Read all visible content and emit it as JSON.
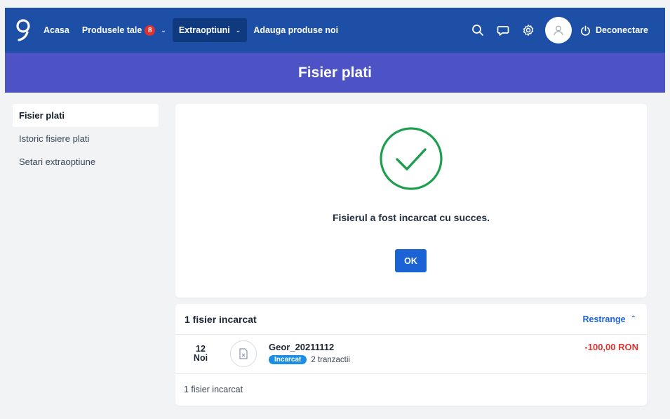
{
  "nav": {
    "home": "Acasa",
    "products": "Produsele tale",
    "products_badge": "8",
    "extras": "Extraoptiuni",
    "add_products": "Adauga produse noi",
    "logout": "Deconectare"
  },
  "page": {
    "title": "Fisier plati"
  },
  "sidebar": {
    "items": [
      {
        "label": "Fisier plati"
      },
      {
        "label": "Istoric fisiere plati"
      },
      {
        "label": "Setari extraoptiune"
      }
    ]
  },
  "success": {
    "message": "Fisierul a fost incarcat cu succes.",
    "ok_label": "OK"
  },
  "files": {
    "title": "1 fisier incarcat",
    "collapse_label": "Restrange",
    "rows": [
      {
        "day": "12",
        "month": "Noi",
        "name": "Geor_20211112",
        "status": "Incarcat",
        "transactions": "2 tranzactii",
        "amount": "-100,00 RON"
      }
    ],
    "footer": "1 fisier incarcat"
  },
  "colors": {
    "nav_bg": "#1e4fa6",
    "band_bg": "#4d52c4",
    "success_green": "#1e9e4f",
    "accent_blue": "#1b63d4",
    "negative_red": "#e0322f"
  },
  "icons": {
    "logo": "brand-logo-icon",
    "search": "search-icon",
    "chat": "chat-bubble-icon",
    "settings": "gear-icon",
    "user": "user-icon",
    "power": "power-icon",
    "check": "check-circle-icon",
    "file": "excel-file-icon"
  }
}
